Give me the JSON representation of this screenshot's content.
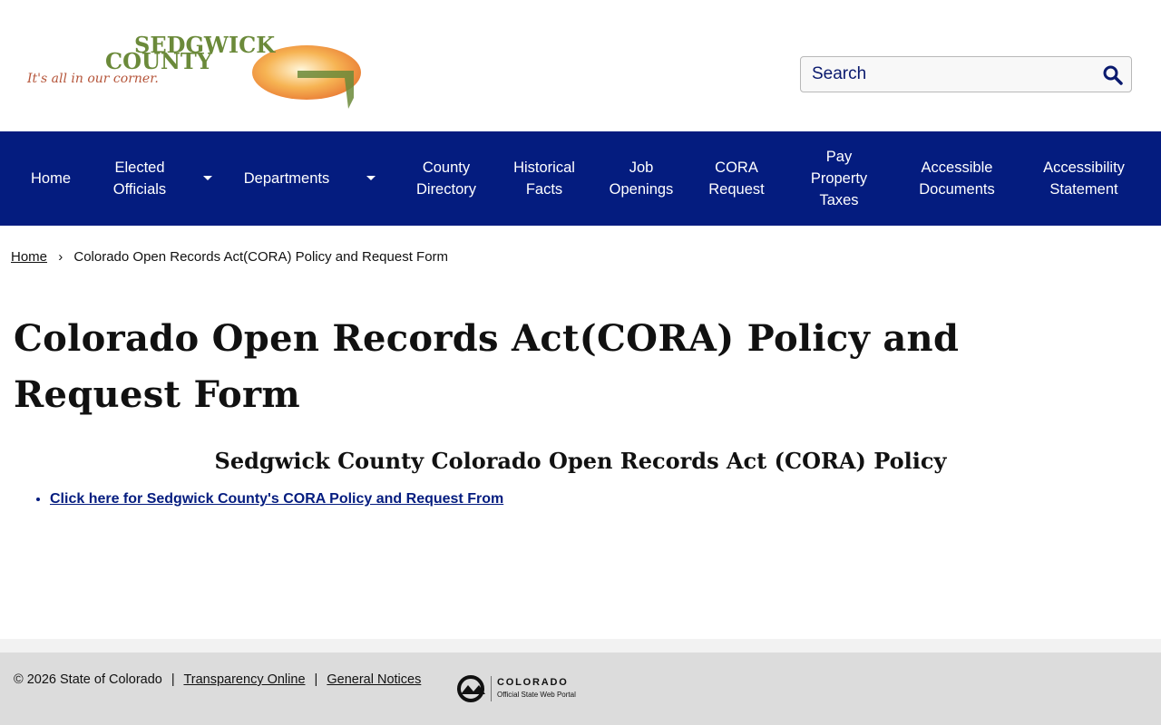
{
  "header": {
    "logo": {
      "name_line1": "SEDGWICK",
      "name_line2": "COUNTY",
      "tagline": "It's all in our corner.",
      "text_color": "#6b8a3a",
      "sun_color": "#f08c2e"
    },
    "search": {
      "placeholder": "Search",
      "icon": "magnifier-icon"
    }
  },
  "nav": {
    "background": "#041c7f",
    "items": [
      {
        "label": "Home"
      },
      {
        "label": "Elected\nOfficials",
        "has_dropdown": true
      },
      {
        "label": "Departments",
        "has_dropdown": true
      },
      {
        "label": "County\nDirectory"
      },
      {
        "label": "Historical\nFacts"
      },
      {
        "label": "Job\nOpenings"
      },
      {
        "label": "CORA\nRequest"
      },
      {
        "label": "Pay\nProperty\nTaxes"
      },
      {
        "label": "Accessible\nDocuments"
      },
      {
        "label": "Accessibility\nStatement"
      }
    ]
  },
  "breadcrumb": {
    "home": "Home",
    "separator": "›",
    "current": "Colorado Open Records Act(CORA) Policy and Request Form"
  },
  "main": {
    "title": "Colorado Open Records Act(CORA) Policy and Request Form",
    "subtitle": "Sedgwick County Colorado Open Records Act (CORA) Policy",
    "links": [
      {
        "label": "Click here for Sedgwick County's CORA Policy and Request From"
      }
    ]
  },
  "footer": {
    "copyright": "© 2026 State of Colorado",
    "separator": "|",
    "links": [
      {
        "label": "Transparency Online"
      },
      {
        "label": "General Notices"
      }
    ],
    "portal_logo": {
      "title": "COLORADO",
      "subtitle": "Official State Web Portal"
    }
  }
}
